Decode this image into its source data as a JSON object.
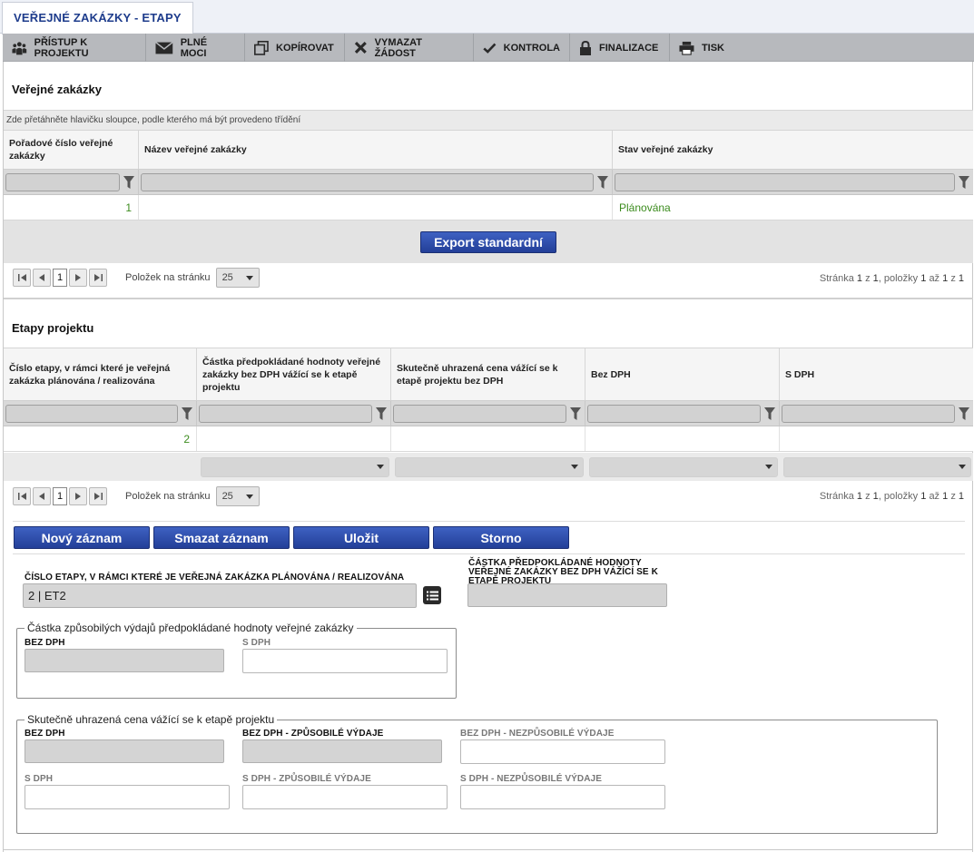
{
  "tab": {
    "title": "VEŘEJNÉ ZAKÁZKY - ETAPY"
  },
  "toolbar": [
    {
      "label": "PŘÍSTUP K PROJEKTU",
      "icon": "people-icon"
    },
    {
      "label": "PLNÉ MOCI",
      "icon": "envelope-icon"
    },
    {
      "label": "KOPÍROVAT",
      "icon": "copy-icon"
    },
    {
      "label": "VYMAZAT ŽÁDOST",
      "icon": "cross-icon"
    },
    {
      "label": "KONTROLA",
      "icon": "checkmark-icon"
    },
    {
      "label": "FINALIZACE",
      "icon": "lock-icon"
    },
    {
      "label": "TISK",
      "icon": "printer-icon"
    }
  ],
  "zakazky": {
    "title": "Veřejné zakázky",
    "group_hint": "Zde přetáhněte hlavičku sloupce, podle kterého má být provedeno třídění",
    "columns": [
      "Pořadové číslo veřejné zakázky",
      "Název veřejné zakázky",
      "Stav veřejné zakázky"
    ],
    "rows": [
      {
        "poradi": "1",
        "nazev": "",
        "stav": "Plánována"
      }
    ],
    "export_label": "Export standardní",
    "pager": {
      "current": "1",
      "per_page_label": "Položek na stránku",
      "per_page": "25",
      "info_prefix": "Stránka",
      "page": "1",
      "of": "z",
      "pages": "1",
      "items_label": ", položky",
      "from": "1",
      "to_label": "až",
      "to": "1",
      "total": "1"
    }
  },
  "etapy": {
    "title": "Etapy projektu",
    "columns": [
      "Číslo etapy, v rámci které je veřejná zakázka plánována / realizována",
      "Částka předpokládané hodnoty veřejné zakázky bez DPH vážící se k etapě projektu",
      "Skutečně uhrazená cena vážící se k etapě projektu bez DPH",
      "Bez DPH",
      "S DPH"
    ],
    "rows": [
      {
        "cislo": "2"
      }
    ],
    "pager": {
      "current": "1",
      "per_page_label": "Položek na stránku",
      "per_page": "25",
      "info_prefix": "Stránka",
      "page": "1",
      "of": "z",
      "pages": "1",
      "items_label": ", položky",
      "from": "1",
      "to_label": "až",
      "to": "1",
      "total": "1"
    }
  },
  "actions": {
    "new": "Nový záznam",
    "delete": "Smazat záznam",
    "save": "Uložit",
    "cancel": "Storno"
  },
  "form": {
    "cislo_etapy_label": "ČÍSLO ETAPY, V RÁMCI KTERÉ JE VEŘEJNÁ ZAKÁZKA PLÁNOVÁNA / REALIZOVÁNA",
    "cislo_etapy_value": "2 | ET2",
    "castka_label": "ČÁSTKA PŘEDPOKLÁDANÉ HODNOTY VEŘEJNÉ ZAKÁZKY BEZ DPH VÁŽÍCÍ SE K ETAPĚ PROJEKTU",
    "group1": {
      "legend": "Částka způsobilých výdajů předpokládané hodnoty veřejné zakázky",
      "bez_dph": "BEZ DPH",
      "s_dph": "S DPH"
    },
    "group2": {
      "legend": "Skutečně uhrazená cena vážící se k etapě projektu",
      "bez_dph": "BEZ DPH",
      "bez_dph_zp": "BEZ DPH - ZPŮSOBILÉ VÝDAJE",
      "bez_dph_nezp": "BEZ DPH - NEZPŮSOBILÉ VÝDAJE",
      "s_dph": "S DPH",
      "s_dph_zp": "S DPH - ZPŮSOBILÉ VÝDAJE",
      "s_dph_nezp": "S DPH - NEZPŮSOBILÉ VÝDAJE"
    }
  },
  "colors": {
    "brand": "#1e3c8c",
    "button": "#2c4aa8",
    "status_green": "#3c8c1e"
  }
}
